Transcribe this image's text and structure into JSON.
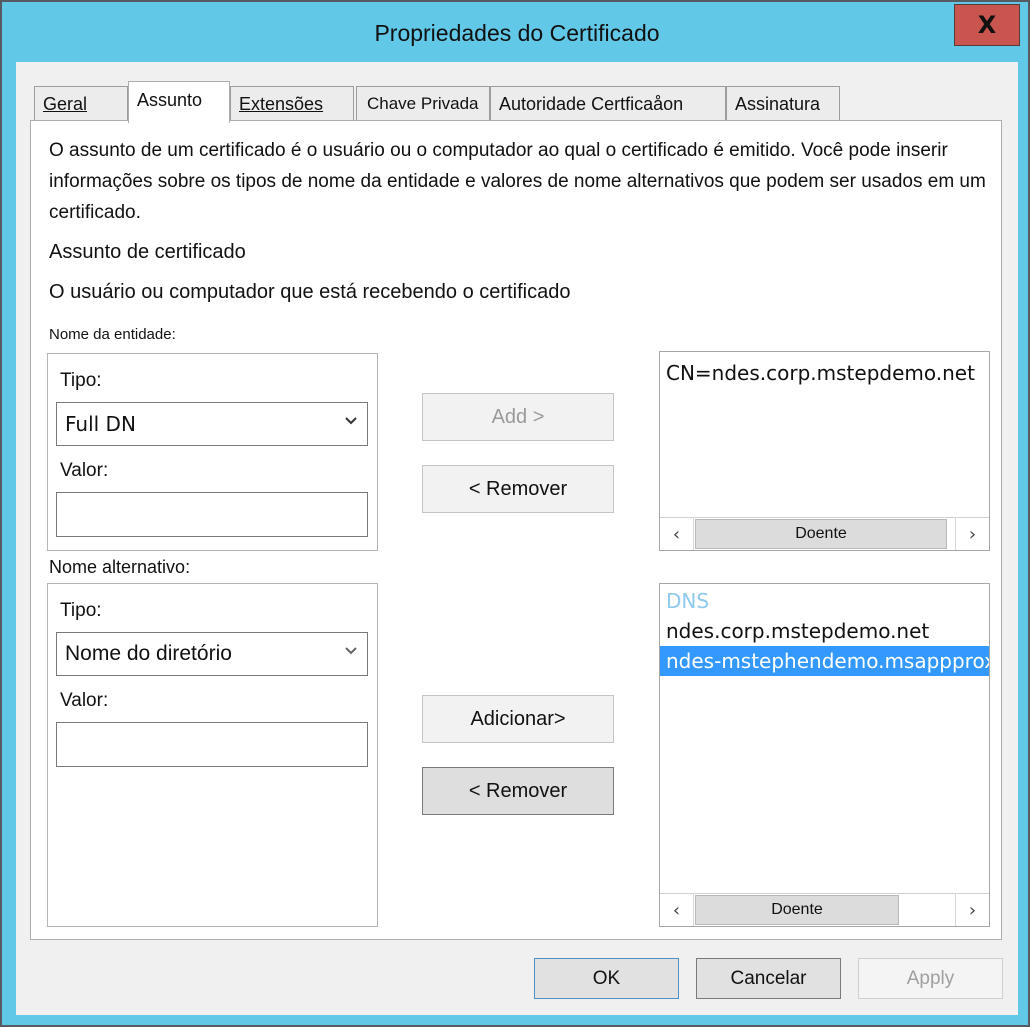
{
  "window": {
    "title": "Propriedades do Certificado",
    "close_label": "X"
  },
  "tabs": [
    {
      "label": "Geral",
      "active": false
    },
    {
      "label": "Assunto",
      "active": true
    },
    {
      "label": "Extensões",
      "active": false
    },
    {
      "label": "Chave Privada",
      "active": false
    },
    {
      "label": "Autoridade Certficaåon",
      "active": false
    },
    {
      "label": "Assinatura",
      "active": false
    }
  ],
  "subject": {
    "description": "O assunto de um certificado é o usuário ou o computador ao qual o certificado é emitido. Você pode inserir informações sobre os tipos de nome da entidade e valores de nome alternativos que podem ser usados em um certificado.",
    "section_title": "Assunto de certificado",
    "section_subtitle": "O usuário ou computador que está recebendo o certificado",
    "entity_name": {
      "label": "Nome da entidade:",
      "type_label": "Tipo:",
      "type_value": "Full DN",
      "value_label": "Valor:",
      "value": "",
      "add_button": "Add >",
      "remove_button": "< Remover",
      "list_items": [
        "CN=ndes.corp.mstepdemo.net"
      ],
      "scroll_thumb_label": "Doente"
    },
    "alternative_name": {
      "label": "Nome alternativo:",
      "type_label": "Tipo:",
      "type_value": "Nome do diretório",
      "value_label": "Valor:",
      "value": "",
      "add_button": "Adicionar>",
      "remove_button": "< Remover",
      "list_header": "DNS",
      "list_items": [
        "ndes.corp.mstepdemo.net",
        "ndes-mstephendemo.msappproxy.net"
      ],
      "selected_item": "ndes-mstephendemo.msappproxy.net",
      "scroll_thumb_label": "Doente"
    }
  },
  "footer": {
    "ok": "OK",
    "cancel": "Cancelar",
    "apply": "Apply"
  }
}
